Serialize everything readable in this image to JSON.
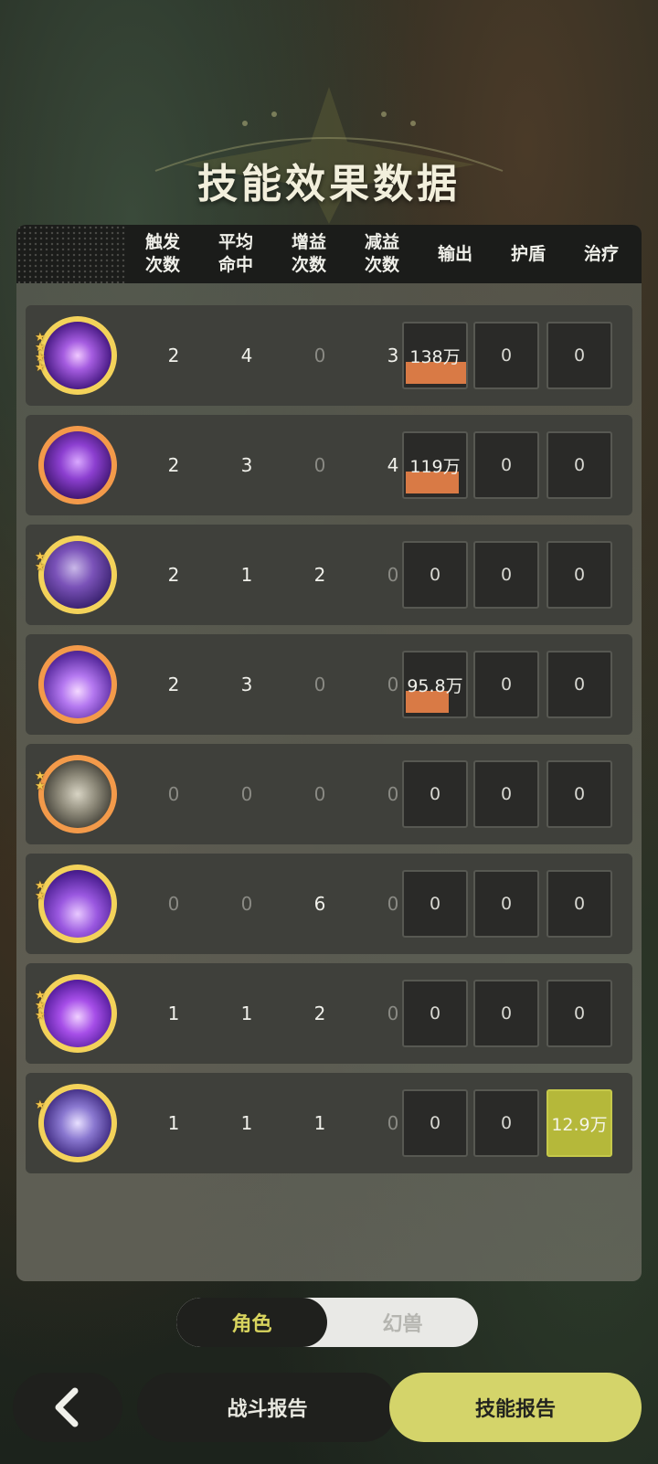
{
  "page": {
    "title": "技能效果数据"
  },
  "headers": [
    "触发\n次数",
    "平均\n命中",
    "增益\n次数",
    "减益\n次数",
    "输出",
    "护盾",
    "治疗"
  ],
  "colors": {
    "output_bar": "#d97a45",
    "heal_highlight": "#b5b83a",
    "accent": "#d4d46a"
  },
  "rows": [
    {
      "icon": "purple-heart-skill-icon",
      "ring": "gold",
      "stars": 4,
      "trigger": "2",
      "hits": "4",
      "buffs": "0",
      "debuffs": "3",
      "output": "138万",
      "output_fraction": 1.0,
      "shield": "0",
      "heal": "0"
    },
    {
      "icon": "ghost-face-skill-icon",
      "ring": "orange",
      "stars": 0,
      "trigger": "2",
      "hits": "3",
      "buffs": "0",
      "debuffs": "4",
      "output": "119万",
      "output_fraction": 0.86,
      "shield": "0",
      "heal": "0"
    },
    {
      "icon": "shadow-claw-skill-icon",
      "ring": "gold",
      "stars": 2,
      "trigger": "2",
      "hits": "1",
      "buffs": "2",
      "debuffs": "0",
      "output": "0",
      "output_fraction": 0,
      "shield": "0",
      "heal": "0"
    },
    {
      "icon": "crystal-burst-skill-icon",
      "ring": "orange",
      "stars": 0,
      "trigger": "2",
      "hits": "3",
      "buffs": "0",
      "debuffs": "0",
      "output": "95.8万",
      "output_fraction": 0.69,
      "shield": "0",
      "heal": "0"
    },
    {
      "icon": "figure-spin-skill-icon",
      "ring": "orange",
      "stars": 2,
      "trigger": "0",
      "hits": "0",
      "buffs": "0",
      "debuffs": "0",
      "output": "0",
      "output_fraction": 0,
      "shield": "0",
      "heal": "0"
    },
    {
      "icon": "silhouette-aura-skill-icon",
      "ring": "gold",
      "stars": 2,
      "trigger": "0",
      "hits": "0",
      "buffs": "6",
      "debuffs": "0",
      "output": "0",
      "output_fraction": 0,
      "shield": "0",
      "heal": "0"
    },
    {
      "icon": "purple-flame-skill-icon",
      "ring": "gold",
      "stars": 3,
      "trigger": "1",
      "hits": "1",
      "buffs": "2",
      "debuffs": "0",
      "output": "0",
      "output_fraction": 0,
      "shield": "0",
      "heal": "0"
    },
    {
      "icon": "lightning-orb-skill-icon",
      "ring": "gold",
      "stars": 1,
      "trigger": "1",
      "hits": "1",
      "buffs": "1",
      "debuffs": "0",
      "output": "0",
      "output_fraction": 0,
      "shield": "0",
      "heal": "12.9万"
    }
  ],
  "toggle": {
    "active": "角色",
    "inactive": "幻兽"
  },
  "bottom_nav": {
    "back_icon": "chevron-left-icon",
    "battle_report": "战斗报告",
    "skill_report": "技能报告"
  }
}
